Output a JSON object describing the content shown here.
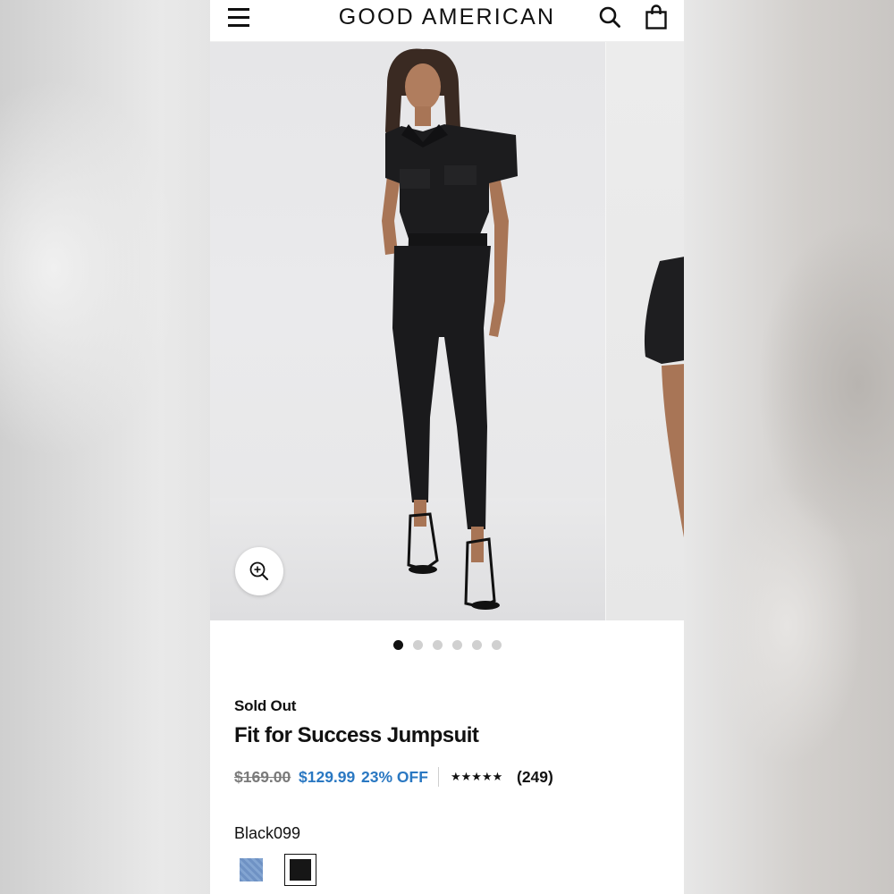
{
  "header": {
    "brand": "GOOD AMERICAN",
    "menu_icon": "hamburger-menu-icon",
    "search_icon": "search-icon",
    "bag_icon": "shopping-bag-icon"
  },
  "gallery": {
    "total_images": 6,
    "active_index": 0,
    "zoom_icon": "zoom-in-icon"
  },
  "product": {
    "status": "Sold Out",
    "title": "Fit for Success Jumpsuit",
    "original_price": "$169.00",
    "sale_price": "$129.99",
    "discount": "23% OFF",
    "rating_stars": "★★★★★",
    "review_count": "(249)",
    "selected_color": "Black099",
    "swatches": [
      {
        "name": "blue-denim",
        "color": "#7a9dcc",
        "selected": false
      },
      {
        "name": "black",
        "color": "#161616",
        "selected": true
      }
    ]
  },
  "colors": {
    "sale": "#2a78c2",
    "text": "#111111",
    "muted": "#7a7a7a"
  }
}
